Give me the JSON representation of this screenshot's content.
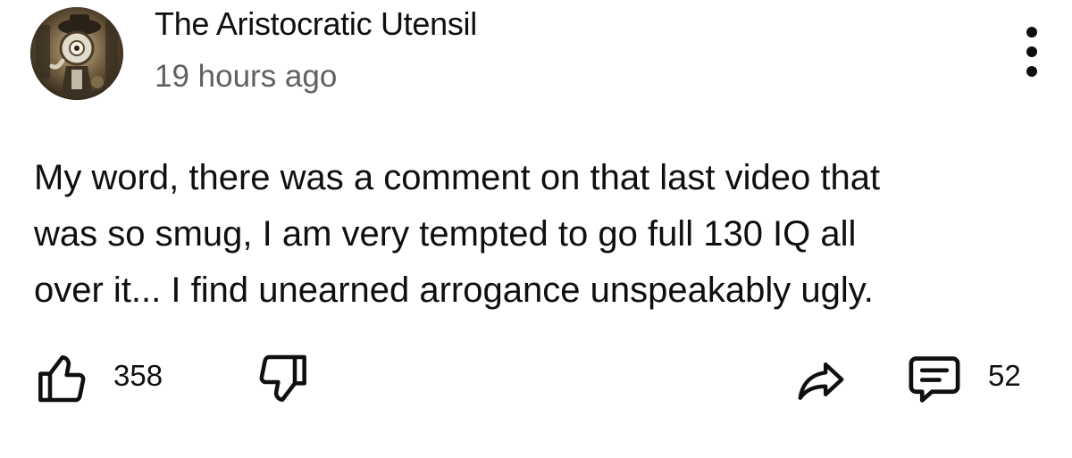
{
  "comment": {
    "author": "The Aristocratic Utensil",
    "timestamp": "19 hours ago",
    "avatar": "avatar-steampunk-figure",
    "lines": [
      "My word, there was a comment on that last video that",
      "was so smug, I am very tempted to go full 130 IQ all",
      "over it... I find unearned arrogance unspeakably ugly."
    ]
  },
  "actions": {
    "like_icon": "thumb-up-icon",
    "like_count": "358",
    "dislike_icon": "thumb-down-icon",
    "share_icon": "share-icon",
    "reply_icon": "comment-icon",
    "reply_count": "52"
  },
  "menu_icon": "more-vertical-icon",
  "colors": {
    "text": "#0f0f0f",
    "secondary_text": "#606060",
    "background": "#ffffff"
  }
}
